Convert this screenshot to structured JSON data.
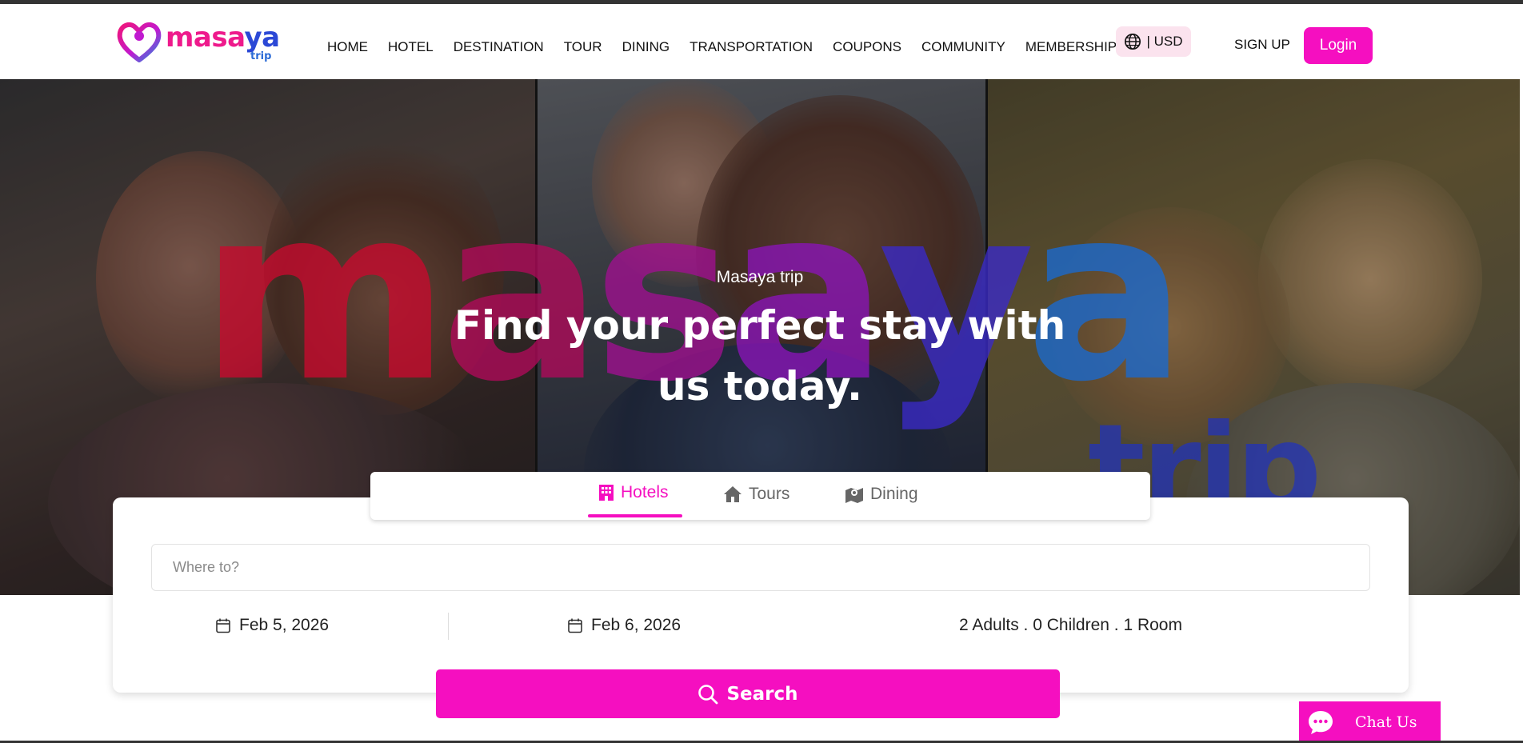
{
  "brand": {
    "name_part1": "masa",
    "name_part2": "ya",
    "sub": "trip",
    "colors": {
      "pink": "#f50fc0",
      "blue": "#2b48d6"
    }
  },
  "nav": {
    "items": [
      {
        "label": "HOME"
      },
      {
        "label": "HOTEL"
      },
      {
        "label": "DESTINATION"
      },
      {
        "label": "TOUR"
      },
      {
        "label": "DINING"
      },
      {
        "label": "TRANSPORTATION"
      },
      {
        "label": "COUPONS"
      },
      {
        "label": "COMMUNITY"
      },
      {
        "label": "MEMBERSHIP"
      }
    ],
    "currency": "| USD",
    "currency_icon": "globe-icon",
    "signup": "SIGN UP",
    "login": "Login"
  },
  "hero": {
    "watermark": [
      "m",
      "a",
      "s",
      "a",
      "y",
      "a"
    ],
    "watermark_sub": "trip",
    "subtitle": "Masaya trip",
    "title": "Find your perfect stay with us today."
  },
  "tabs": [
    {
      "label": "Hotels",
      "icon": "building-icon",
      "active": true
    },
    {
      "label": "Tours",
      "icon": "home-icon",
      "active": false
    },
    {
      "label": "Dining",
      "icon": "map-icon",
      "active": false
    }
  ],
  "search": {
    "where_placeholder": "Where to?",
    "checkin": "Feb 5, 2026",
    "checkout": "Feb 6, 2026",
    "guests": "2 Adults . 0 Children . 1 Room",
    "button": "Search"
  },
  "chat": {
    "label": "Chat Us"
  }
}
